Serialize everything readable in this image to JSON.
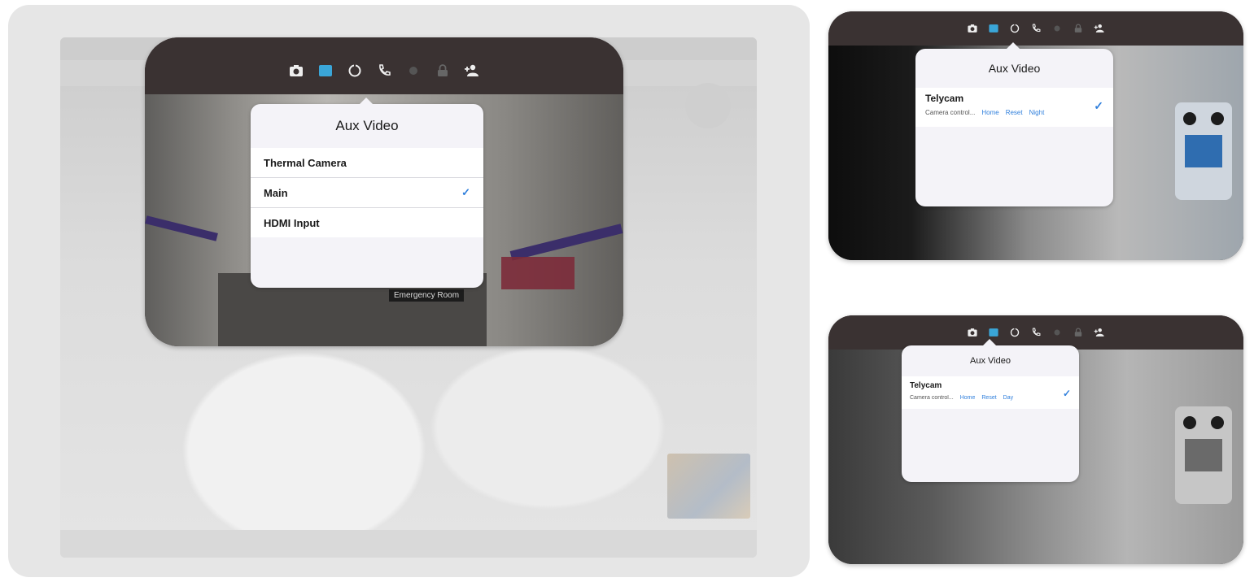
{
  "toolbar_icons": [
    "camera-icon",
    "video-source-icon",
    "rotate-icon",
    "phone-icon",
    "record-icon",
    "lock-icon",
    "add-person-icon"
  ],
  "left_card": {
    "popover_title": "Aux Video",
    "options": [
      {
        "label": "Thermal Camera",
        "selected": false
      },
      {
        "label": "Main",
        "selected": true
      },
      {
        "label": "HDMI Input",
        "selected": false
      }
    ],
    "scene_sign": "Emergency Room"
  },
  "top_right_card": {
    "popover_title": "Aux Video",
    "camera_name": "Telycam",
    "camera_sub_label": "Camera control...",
    "camera_actions": [
      "Home",
      "Reset",
      "Night"
    ],
    "selected": true
  },
  "bottom_right_card": {
    "popover_title": "Aux Video",
    "camera_name": "Telycam",
    "camera_sub_label": "Camera control...",
    "camera_actions": [
      "Home",
      "Reset",
      "Day"
    ],
    "selected": true
  },
  "check_mark": "✓",
  "colors": {
    "accent": "#2f7fdc",
    "toolbar": "#3a3232",
    "popover": "#f4f3f8"
  }
}
